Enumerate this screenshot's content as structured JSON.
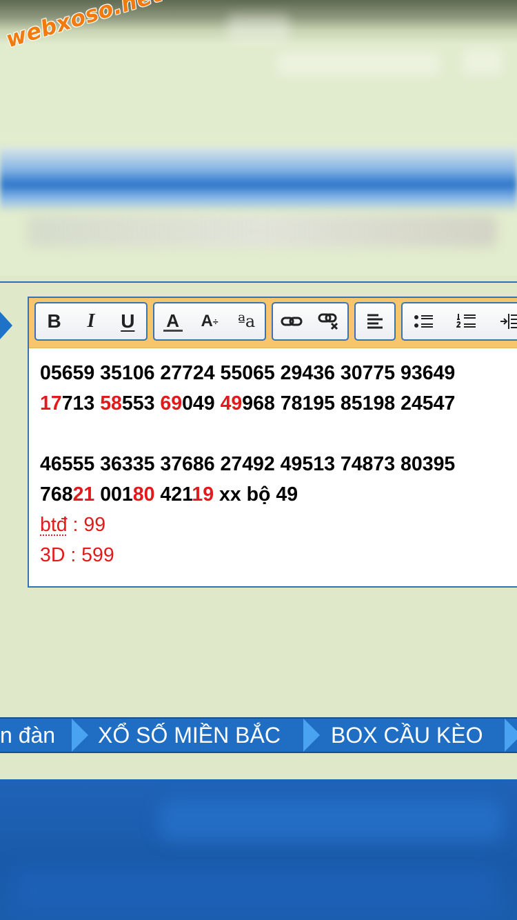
{
  "watermark": "webxoso.net",
  "toolbar": {
    "bold": "B",
    "italic": "I",
    "underline": "U",
    "font_color": "A",
    "font_size": "A",
    "font_size_mark": "÷",
    "font_family": "ªa"
  },
  "post": {
    "line1": "05659 35106 27724 55065 29436 30775 93649",
    "line2": [
      {
        "hl": "17",
        "rest": "713"
      },
      {
        "hl": "58",
        "rest": "553"
      },
      {
        "hl": "69",
        "rest": "049"
      },
      {
        "hl": "49",
        "rest": "968"
      }
    ],
    "line2_tail": "78195 85198 24547",
    "line3": "46555 36335 37686 27492 49513 74873 80395",
    "line4": [
      {
        "pre": "768",
        "hl": "21"
      },
      {
        "pre": "001",
        "hl": "80"
      },
      {
        "pre": "421",
        "hl": "19"
      }
    ],
    "line4_tail": "xx bộ 49",
    "btd_label": "btđ",
    "btd_value": " : 99",
    "d3": "3D : 599"
  },
  "nav": {
    "item1": "n đàn",
    "item2": "XỔ SỐ MIỀN BẮC",
    "item3": "BOX CẦU KÈO"
  },
  "colors": {
    "highlight": "#e11b1b",
    "nav_bg": "#1f6ec4",
    "toolbar_bg": "#f7c66c",
    "watermark": "#f27b10"
  }
}
